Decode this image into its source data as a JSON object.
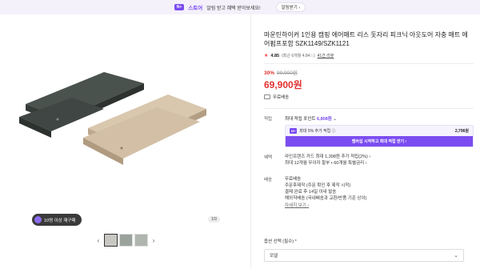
{
  "banner": {
    "logo": "N+",
    "brand": "스토어",
    "text": "알림 받고 혜택 받아보세요!",
    "button": "알림받기 ›"
  },
  "gallery": {
    "badge": "10명 이상 재구매",
    "counter": "1/3"
  },
  "product": {
    "title": "마운틴하이커 1인용 캠핑 에어매트 리스 돗자리 피크닉 아웃도어 자충 매트 에어펌프포함 SZK1149/SZK1121",
    "rating": "4.85",
    "rating_detail": "(최근 6개월 4.84☆)",
    "review_link": "41건 리뷰",
    "discount": "30%",
    "original_price": "99,900원",
    "price": "69,900원",
    "shipping": "무료배송"
  },
  "points": {
    "label": "적립",
    "max_prefix": "최대 적립 포인트",
    "max_value": "6,808원",
    "box_logo": "N+",
    "box_text": "최대 5% 추가 적립 ⓘ",
    "box_points": "2,796원",
    "button": "멤버십 시작하고 최대 적립 받기 ›"
  },
  "benefits": {
    "label": "혜택",
    "lines": [
      "라인프렌즈 카드 최대 1,398원 추가 적립(2%) ›",
      "최대 12개월 무이자 할부 • 60개월 특별금리 ›"
    ]
  },
  "delivery": {
    "label": "배송",
    "lines": [
      "무료배송",
      "주문후제작 (주문 확인 후 제작 시작)",
      "결제 완료 후 14일 이내 발송",
      "해외직배송 (국내배송과 교환/반품 기준 상이)"
    ],
    "more": "자세히 보기 ›"
  },
  "options": {
    "label": "옵션 선택 (필수) *",
    "select_value": "모델"
  },
  "colors": {
    "accent": "#7b4cf0",
    "price": "#e03131"
  }
}
